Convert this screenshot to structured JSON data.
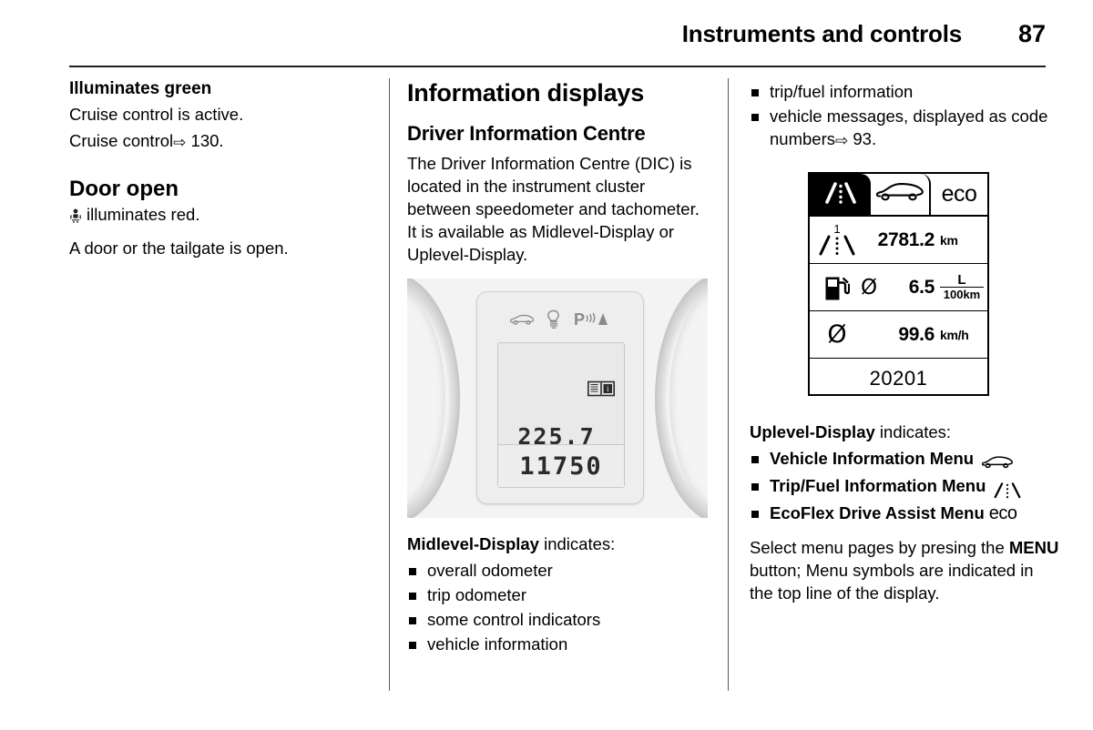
{
  "header": {
    "title": "Instruments and controls",
    "page_number": "87"
  },
  "left_column": {
    "section1": {
      "heading": "Illuminates green",
      "line1": "Cruise control is active.",
      "line2_prefix": "Cruise control",
      "arrow": "⇨",
      "line2_ref": "130."
    },
    "section2": {
      "heading": "Door open",
      "icon": "door-open-icon",
      "line1": "illuminates red.",
      "line2": "A door or the tailgate is open."
    }
  },
  "middle_column": {
    "section_title": "Information displays",
    "sub_title": "Driver Information Centre",
    "paragraph": "The Driver Information Centre (DIC) is located in the instrument cluster between speedometer and tachometer. It is available as Midlevel-Display or Uplevel-Display.",
    "midlevel_photo": {
      "caption_icons": [
        "car-icon",
        "bulb-icon",
        "park-assist-icon"
      ],
      "book_icon": "manual-book-info-icon",
      "trip_value": "225.7",
      "odometer_value": "11750"
    },
    "list_title_bold": "Midlevel-Display",
    "list_title_rest": " indicates:",
    "bullets": [
      "overall odometer",
      "trip odometer",
      "some control indicators",
      "vehicle information"
    ]
  },
  "right_column": {
    "top_bullets": [
      "trip/fuel information",
      "vehicle messages, displayed as code numbers"
    ],
    "top_bullet_arrow": "⇨",
    "top_bullet_ref": "93.",
    "uplevel_display": {
      "tabs": [
        {
          "name": "trip-fuel-tab",
          "icon": "road-lane-icon",
          "active": true
        },
        {
          "name": "vehicle-info-tab",
          "icon": "car-side-icon",
          "active": false
        },
        {
          "name": "ecoflex-tab",
          "label": "eco",
          "active": false
        }
      ],
      "rows": [
        {
          "icon": "road-lane-trip1-icon",
          "trip_index": "1",
          "value": "2781.2",
          "unit": "km"
        },
        {
          "icon": "fuel-pump-icon",
          "avg_symbol": "Ø",
          "value": "6.5",
          "unit_numerator": "L",
          "unit_denominator": "100km"
        },
        {
          "icon": "average-speed-icon",
          "avg_symbol": "Ø",
          "value": "99.6",
          "unit": "km/h"
        }
      ],
      "total_value": "20201"
    },
    "list_title_bold": "Uplevel-Display",
    "list_title_rest": " indicates:",
    "menu_bullets": [
      {
        "label": "Vehicle Information Menu",
        "icon": "car-side-icon"
      },
      {
        "label": "Trip/Fuel Information Menu",
        "icon": "road-lane-icon"
      },
      {
        "label": "EcoFlex Drive Assist Menu",
        "icon": "eco-text-icon",
        "icon_text": "eco"
      }
    ],
    "footer_paragraph_1": "Select menu pages by presing the ",
    "footer_menu_button": "MENU",
    "footer_paragraph_2": " button; Menu symbols are indicated in the top line of the display."
  }
}
